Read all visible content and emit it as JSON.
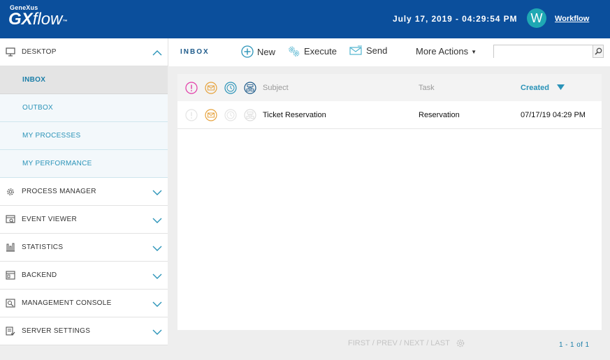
{
  "header": {
    "brand_small": "GeneXus",
    "brand_gx": "GX",
    "brand_flow": "flow",
    "brand_tm": "™",
    "datetime": "July 17, 2019 - 04:29:54 PM",
    "avatar_letter": "W",
    "user_link": "Workflow"
  },
  "sidebar": {
    "desktop": {
      "label": "DESKTOP",
      "icon": "monitor-icon",
      "expanded": true
    },
    "desktop_items": [
      {
        "label": "INBOX",
        "active": true
      },
      {
        "label": "OUTBOX"
      },
      {
        "label": "MY PROCESSES"
      },
      {
        "label": "MY PERFORMANCE"
      }
    ],
    "sections": [
      {
        "label": "PROCESS MANAGER",
        "icon": "gear-icon"
      },
      {
        "label": "EVENT VIEWER",
        "icon": "event-viewer-icon"
      },
      {
        "label": "STATISTICS",
        "icon": "statistics-icon"
      },
      {
        "label": "BACKEND",
        "icon": "backend-icon"
      },
      {
        "label": "MANAGEMENT CONSOLE",
        "icon": "management-console-icon"
      },
      {
        "label": "SERVER SETTINGS",
        "icon": "server-settings-icon"
      }
    ]
  },
  "toolbar": {
    "title": "INBOX",
    "new_label": "New",
    "execute_label": "Execute",
    "send_label": "Send",
    "more_actions_label": "More Actions",
    "search_value": "",
    "search_placeholder": ""
  },
  "grid": {
    "columns": {
      "subject": "Subject",
      "task": "Task",
      "created": "Created"
    },
    "sort": {
      "column": "Created",
      "direction": "descending"
    },
    "rows": [
      {
        "subject": "Ticket Reservation",
        "task": "Reservation",
        "created": "07/17/19 04:29 PM"
      }
    ]
  },
  "pager": {
    "first": "FIRST",
    "prev": "PREV",
    "next": "NEXT",
    "last": "LAST",
    "separator": "/",
    "count": "1 - 1 of 1"
  },
  "colors": {
    "header_bg": "#0b4f9c",
    "accent": "#2a93b8",
    "avatar": "#1fa8b3",
    "priority": "#e23aa7",
    "message": "#e6a23c",
    "deadline": "#2a93b8",
    "process": "#1d5a8a"
  }
}
